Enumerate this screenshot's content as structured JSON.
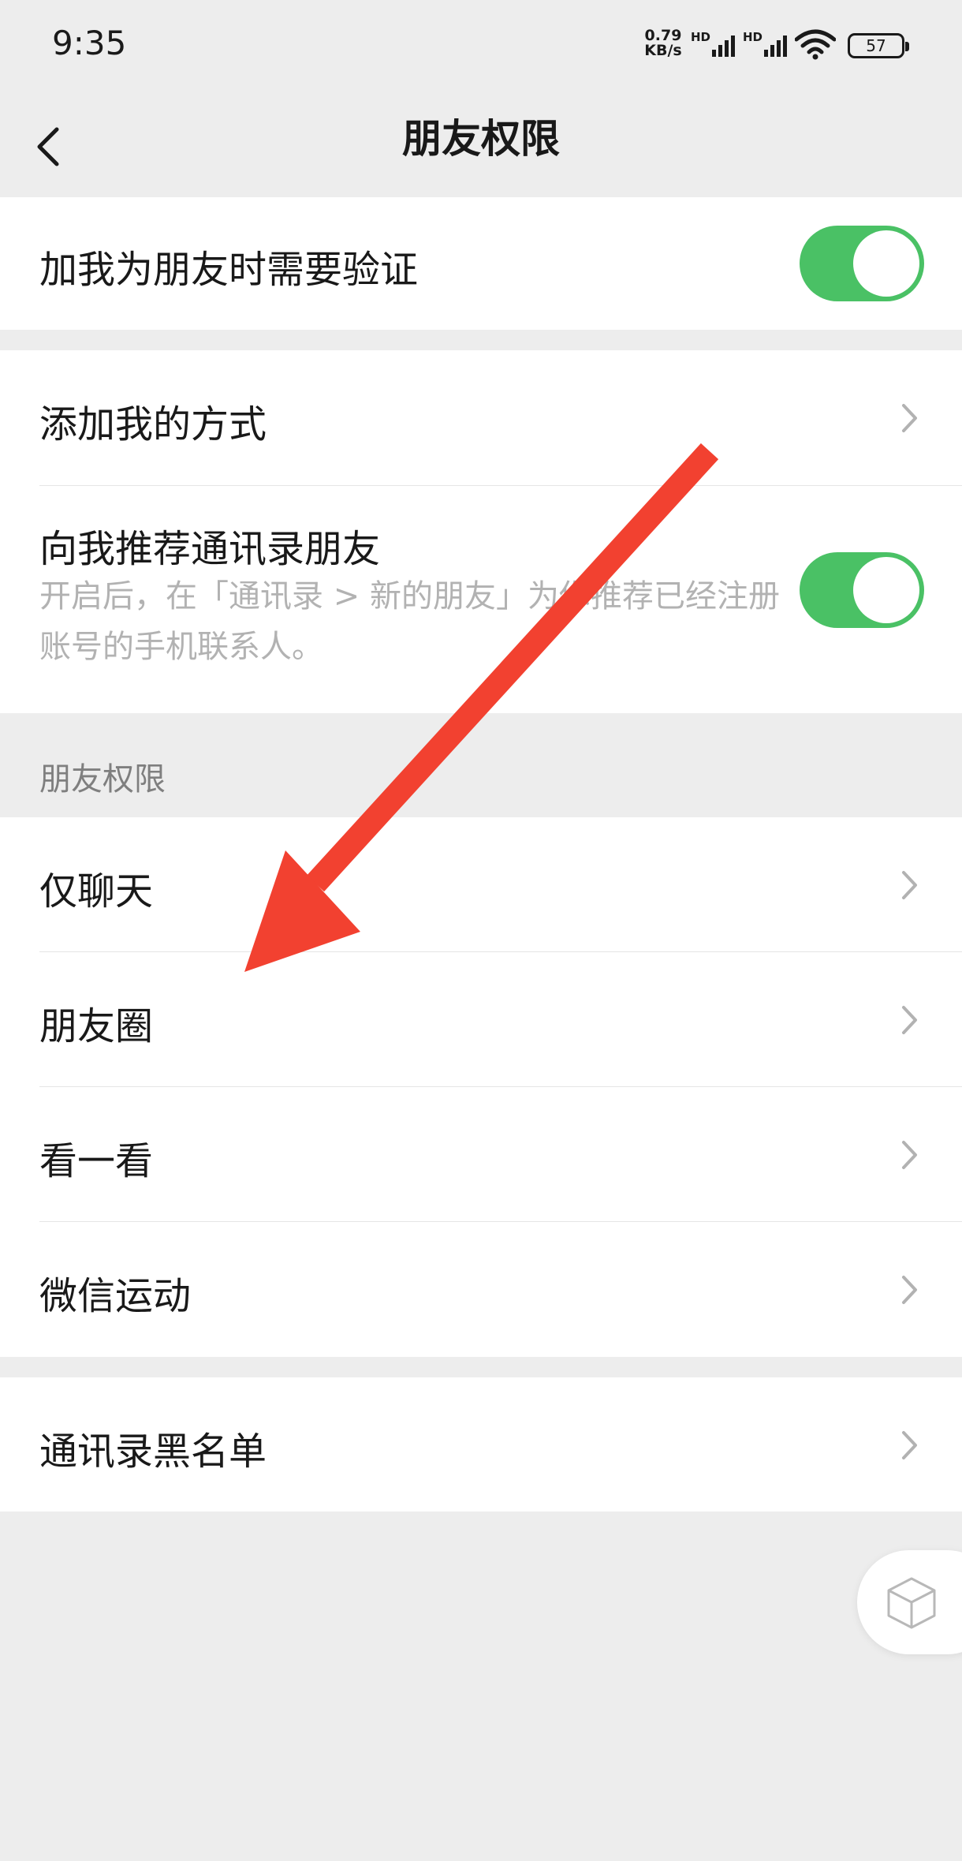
{
  "status_bar": {
    "time": "9:35",
    "net_speed_value": "0.79",
    "net_speed_unit": "KB/s",
    "hd1": "HD",
    "hd2": "HD",
    "battery": "57"
  },
  "nav": {
    "title": "朋友权限",
    "back_icon": "chevron-left-icon"
  },
  "sections": {
    "verify": {
      "label": "加我为朋友时需要验证",
      "toggle_on": true
    },
    "add_methods": {
      "label": "添加我的方式"
    },
    "recommend": {
      "label": "向我推荐通讯录朋友",
      "description": "开启后，在「通讯录 > 新的朋友」为你推荐已经注册账号的手机联系人。",
      "toggle_on": true
    },
    "permissions_header": "朋友权限",
    "permissions": [
      {
        "label": "仅聊天"
      },
      {
        "label": "朋友圈"
      },
      {
        "label": "看一看"
      },
      {
        "label": "微信运动"
      }
    ],
    "blacklist": {
      "label": "通讯录黑名单"
    }
  },
  "colors": {
    "toggle_on": "#4ac165",
    "background": "#ededed",
    "annotation_arrow": "#f24130"
  },
  "icons": {
    "row_chevron": "chevron-right-icon",
    "float_button": "cube-icon"
  }
}
